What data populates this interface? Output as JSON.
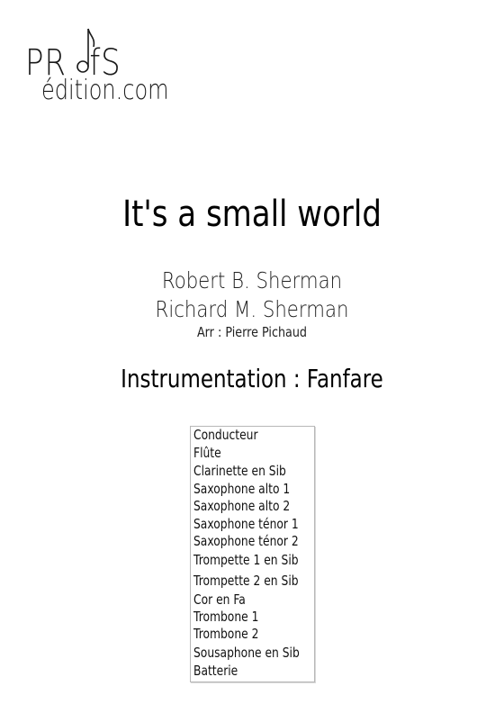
{
  "logo": {
    "top_text": "PR",
    "top_text_end": "fS",
    "bottom_text": "édition.com"
  },
  "title": "It's a small world",
  "composers": [
    "Robert B. Sherman",
    "Richard M. Sherman"
  ],
  "arranger": "Arr : Pierre Pichaud",
  "instrumentation": "Instrumentation : Fanfare",
  "instruments": [
    "Conducteur",
    "Flûte",
    "Clarinette en Sib",
    "Saxophone alto 1",
    "Saxophone alto 2",
    "Saxophone ténor 1",
    "Saxophone ténor 2",
    "Trompette 1 en Sib",
    "Trompette 2 en Sib",
    "Cor en Fa",
    "Trombone 1",
    "Trombone 2",
    "Sousaphone en Sib",
    "Batterie"
  ]
}
